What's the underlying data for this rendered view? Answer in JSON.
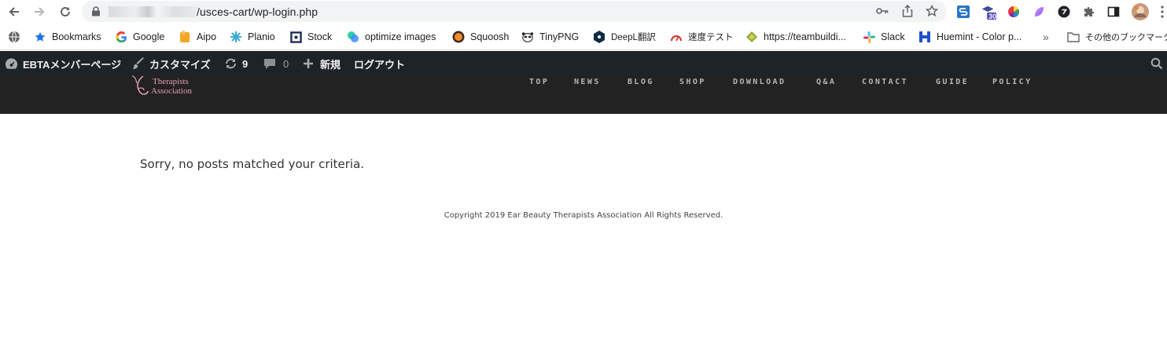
{
  "browser": {
    "url_path": "/usces-cart/wp-login.php",
    "extension_badge": "30"
  },
  "bookmarks": [
    {
      "label": "Bookmarks",
      "icon": "star-icon"
    },
    {
      "label": "Google",
      "icon": "google-icon"
    },
    {
      "label": "Aipo",
      "icon": "aipo-icon"
    },
    {
      "label": "Planio",
      "icon": "planio-icon"
    },
    {
      "label": "Stock",
      "icon": "stock-icon"
    },
    {
      "label": "optimize images",
      "icon": "optimize-icon"
    },
    {
      "label": "Squoosh",
      "icon": "squoosh-icon"
    },
    {
      "label": "TinyPNG",
      "icon": "tinypng-icon"
    },
    {
      "label": "DeepL翻訳",
      "icon": "deepl-icon"
    },
    {
      "label": "速度テスト",
      "icon": "speedtest-icon"
    },
    {
      "label": "https://teambuildi...",
      "icon": "teambuilding-icon"
    },
    {
      "label": "Slack",
      "icon": "slack-icon"
    },
    {
      "label": "Huemint - Color p...",
      "icon": "huemint-icon"
    },
    {
      "label": "その他のブックマーク",
      "icon": "folder-icon"
    }
  ],
  "adminbar": {
    "site_name": "EBTAメンバーページ",
    "customize": "カスタマイズ",
    "updates_count": "9",
    "comments_count": "0",
    "new_label": "新規",
    "logout": "ログアウト"
  },
  "site": {
    "logo_line1": "Therapists",
    "logo_line2": "Association",
    "menu": [
      "TOP",
      "NEWS",
      "BLOG",
      "SHOP",
      "DOWNLOAD",
      "Q&A",
      "CONTACT",
      "GUIDE",
      "POLICY"
    ]
  },
  "content": {
    "message": "Sorry, no posts matched your criteria."
  },
  "footer": {
    "copyright": "Copyright 2019 Ear Beauty Therapists Association All Rights Reserved."
  },
  "colors": {
    "adminbar_bg": "#1d2327",
    "site_header_bg": "#222222",
    "logo_pink": "#e59cb6"
  }
}
